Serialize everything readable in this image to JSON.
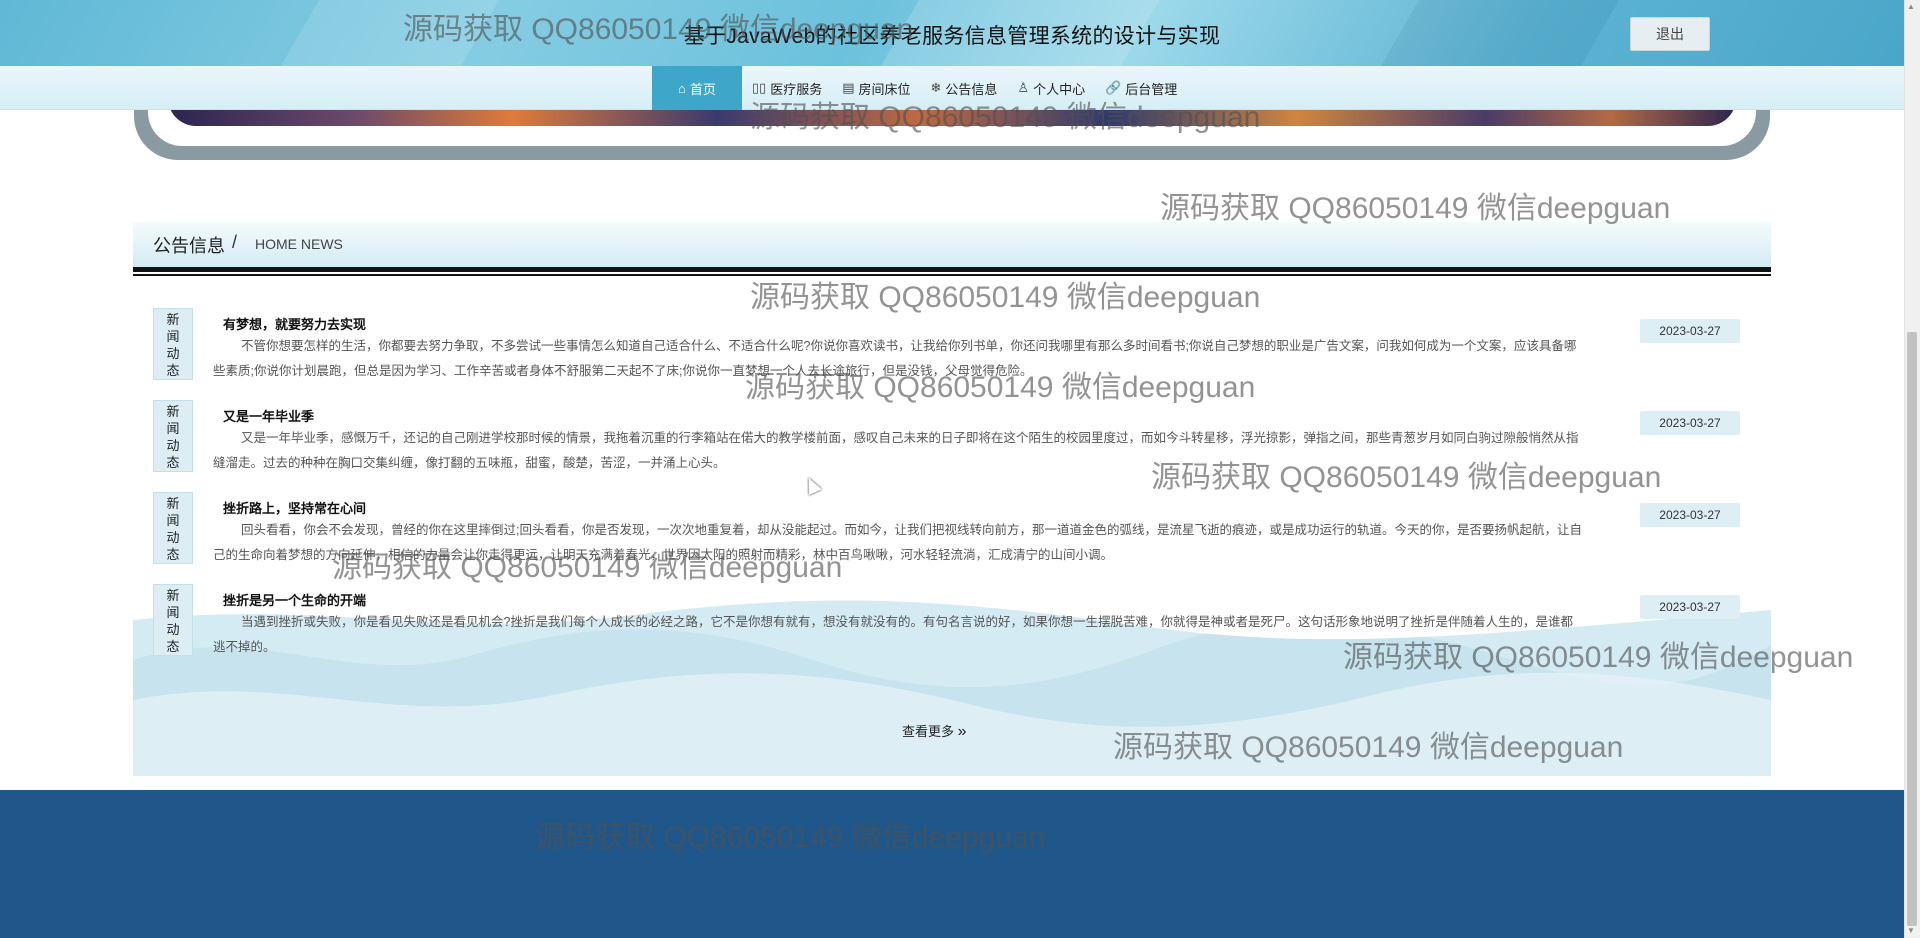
{
  "header": {
    "title": "基于JavaWeb的社区养老服务信息管理系统的设计与实现",
    "logout_label": "退出"
  },
  "nav": {
    "items": [
      {
        "label": "首页",
        "icon": "home-icon",
        "glyph": "⌂",
        "active": true
      },
      {
        "label": "医疗服务",
        "icon": "medical-icon",
        "glyph": "▯▯",
        "active": false
      },
      {
        "label": "房间床位",
        "icon": "calendar-icon",
        "glyph": "▤",
        "active": false
      },
      {
        "label": "公告信息",
        "icon": "snowflake-icon",
        "glyph": "❄",
        "active": false
      },
      {
        "label": "个人中心",
        "icon": "user-icon",
        "glyph": "♙",
        "active": false
      },
      {
        "label": "后台管理",
        "icon": "link-icon",
        "glyph": "🔗",
        "active": false
      }
    ]
  },
  "news": {
    "section_title": "公告信息",
    "separator": "/",
    "section_subtitle": "HOME NEWS",
    "items": [
      {
        "tag": "新闻动态",
        "title": "有梦想，就要努力去实现",
        "desc": "不管你想要怎样的生活，你都要去努力争取，不多尝试一些事情怎么知道自己适合什么、不适合什么呢?你说你喜欢读书，让我给你列书单，你还问我哪里有那么多时间看书;你说自己梦想的职业是广告文案，问我如何成为一个文案，应该具备哪些素质;你说你计划晨跑，但总是因为学习、工作辛苦或者身体不舒服第二天起不了床;你说你一直梦想一个人去长途旅行，但是没钱，父母觉得危险。",
        "date": "2023-03-27"
      },
      {
        "tag": "新闻动态",
        "title": "又是一年毕业季",
        "desc": "又是一年毕业季，感慨万千，还记的自己刚进学校那时候的情景，我拖着沉重的行李箱站在偌大的教学楼前面，感叹自己未来的日子即将在这个陌生的校园里度过，而如今斗转星移，浮光掠影，弹指之间，那些青葱岁月如同白驹过隙般悄然从指缝溜走。过去的种种在胸口交集纠缠，像打翻的五味瓶，甜蜜，酸楚，苦涩，一并涌上心头。",
        "date": "2023-03-27"
      },
      {
        "tag": "新闻动态",
        "title": "挫折路上，坚持常在心间",
        "desc": "回头看看，你会不会发现，曾经的你在这里摔倒过;回头看看，你是否发现，一次次地重复着，却从没能起过。而如今，让我们把视线转向前方，那一道道金色的弧线，是流星飞逝的痕迹，或是成功运行的轨道。今天的你，是否要扬帆起航，让自己的生命向着梦想的方向延伸，相信的力量会让你走得更远，让明天充满着春光，世界因太阳的照射而精彩，林中百鸟啾啾，河水轻轻流淌，汇成清宁的山间小调。",
        "date": "2023-03-27"
      },
      {
        "tag": "新闻动态",
        "title": "挫折是另一个生命的开端",
        "desc": "当遇到挫折或失败，你是看见失败还是看见机会?挫折是我们每个人成长的必经之路，它不是你想有就有，想没有就没有的。有句名言说的好，如果你想一生摆脱苦难，你就得是神或者是死尸。这句话形象地说明了挫折是伴随着人生的，是谁都逃不掉的。",
        "date": "2023-03-27"
      }
    ],
    "more_label": "查看更多",
    "more_glyph": "»"
  },
  "watermark_text": "源码获取 QQ86050149 微信deepguan",
  "colors": {
    "header": "#5fb8d6",
    "nav_active": "#3ea7c9",
    "footer": "#20578a",
    "news_bg": "#d4ebf3"
  }
}
